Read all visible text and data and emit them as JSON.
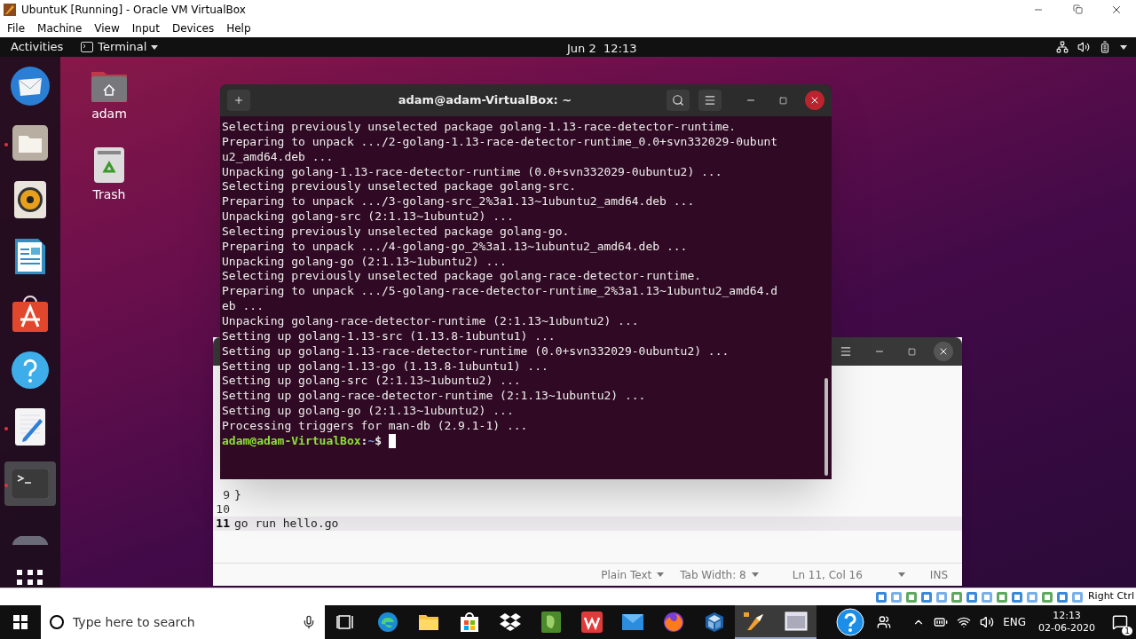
{
  "vbox": {
    "title": "UbuntuK [Running] - Oracle VM VirtualBox",
    "menu": [
      "File",
      "Machine",
      "View",
      "Input",
      "Devices",
      "Help"
    ],
    "host_key": "Right Ctrl"
  },
  "topbar": {
    "activities": "Activities",
    "app": "Terminal",
    "clock": "Jun 2  12:13"
  },
  "dock": [
    {
      "kind": "mail",
      "running": false,
      "selected": false
    },
    {
      "kind": "files",
      "running": true,
      "selected": false
    },
    {
      "kind": "music",
      "running": false,
      "selected": false
    },
    {
      "kind": "writer",
      "running": false,
      "selected": false
    },
    {
      "kind": "software",
      "running": false,
      "selected": false
    },
    {
      "kind": "help",
      "running": false,
      "selected": false
    },
    {
      "kind": "editor",
      "running": true,
      "selected": false
    },
    {
      "kind": "terminal",
      "running": true,
      "selected": true
    },
    {
      "kind": "disc",
      "running": false,
      "selected": false
    }
  ],
  "desktop_icons": [
    {
      "kind": "home",
      "label": "adam"
    },
    {
      "kind": "trash",
      "label": "Trash"
    }
  ],
  "editor": {
    "lines": [
      {
        "number": "9",
        "text": "}",
        "current": false
      },
      {
        "number": "10",
        "current": false
      },
      {
        "number": "11",
        "text": "go run hello.go",
        "current": true
      }
    ],
    "status": [
      {
        "label": "Plain Text",
        "dropdown": true
      },
      {
        "label": "Tab Width: 8",
        "dropdown": true
      },
      {
        "label": "Ln 11, Col 16",
        "dropdown": true
      },
      {
        "label": "INS",
        "dropdown": false
      }
    ]
  },
  "terminal": {
    "title": "adam@adam-VirtualBox: ~",
    "lines": [
      "Selecting previously unselected package golang-1.13-race-detector-runtime.",
      "Preparing to unpack .../2-golang-1.13-race-detector-runtime_0.0+svn332029-0ubunt",
      "u2_amd64.deb ...",
      "Unpacking golang-1.13-race-detector-runtime (0.0+svn332029-0ubuntu2) ...",
      "Selecting previously unselected package golang-src.",
      "Preparing to unpack .../3-golang-src_2%3a1.13~1ubuntu2_amd64.deb ...",
      "Unpacking golang-src (2:1.13~1ubuntu2) ...",
      "Selecting previously unselected package golang-go.",
      "Preparing to unpack .../4-golang-go_2%3a1.13~1ubuntu2_amd64.deb ...",
      "Unpacking golang-go (2:1.13~1ubuntu2) ...",
      "Selecting previously unselected package golang-race-detector-runtime.",
      "Preparing to unpack .../5-golang-race-detector-runtime_2%3a1.13~1ubuntu2_amd64.d",
      "eb ...",
      "Unpacking golang-race-detector-runtime (2:1.13~1ubuntu2) ...",
      "Setting up golang-1.13-src (1.13.8-1ubuntu1) ...",
      "Setting up golang-1.13-race-detector-runtime (0.0+svn332029-0ubuntu2) ...",
      "Setting up golang-1.13-go (1.13.8-1ubuntu1) ...",
      "Setting up golang-src (2:1.13~1ubuntu2) ...",
      "Setting up golang-race-detector-runtime (2:1.13~1ubuntu2) ...",
      "Setting up golang-go (2:1.13~1ubuntu2) ...",
      "Processing triggers for man-db (2.9.1-1) ..."
    ],
    "prompt": {
      "user_host": "adam@adam-VirtualBox",
      "separator": ":",
      "path": "~",
      "symbol": "$"
    }
  },
  "taskbar": {
    "search_placeholder": "Type here to search",
    "apps": [
      {
        "kind": "browser",
        "selected": false
      },
      {
        "kind": "folder",
        "selected": false
      },
      {
        "kind": "store",
        "selected": false
      },
      {
        "kind": "dropbox",
        "selected": false
      },
      {
        "kind": "notes",
        "selected": false
      },
      {
        "kind": "office",
        "selected": false
      },
      {
        "kind": "mail",
        "selected": false
      },
      {
        "kind": "firefox",
        "selected": false
      },
      {
        "kind": "cube",
        "selected": false
      },
      {
        "kind": "tool",
        "selected": true
      },
      {
        "kind": "window",
        "selected": true
      }
    ],
    "language": "ENG",
    "time": "12:13",
    "date": "02-06-2020",
    "notifications": "1"
  }
}
